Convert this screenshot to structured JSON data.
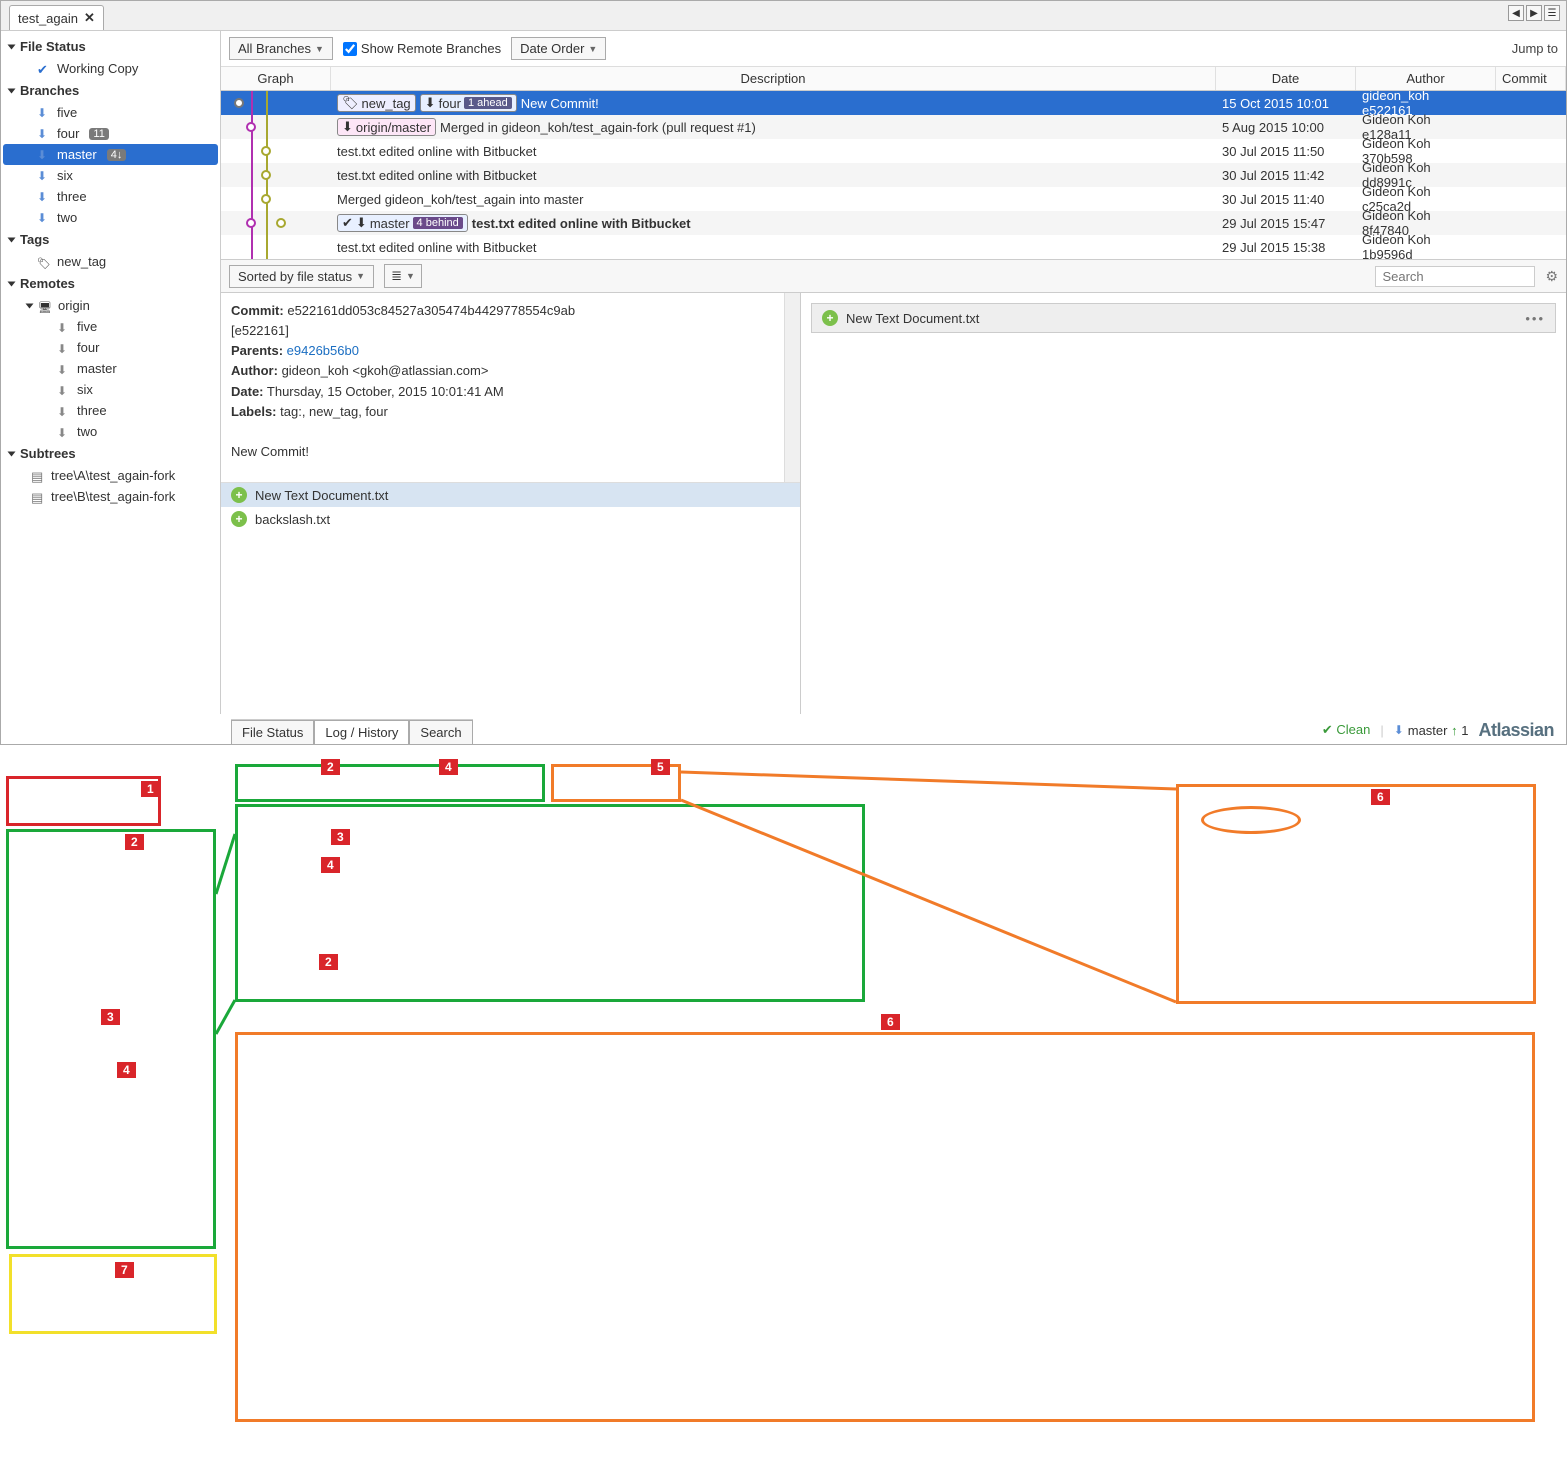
{
  "tab": {
    "name": "test_again"
  },
  "jump_label": "Jump to",
  "sidebar": {
    "file_status": {
      "title": "File Status",
      "items": [
        {
          "label": "Working Copy"
        }
      ]
    },
    "branches": {
      "title": "Branches",
      "items": [
        {
          "label": "five"
        },
        {
          "label": "four",
          "count": "11"
        },
        {
          "label": "master",
          "count": "4↓",
          "active": true
        },
        {
          "label": "six"
        },
        {
          "label": "three"
        },
        {
          "label": "two"
        }
      ]
    },
    "tags": {
      "title": "Tags",
      "items": [
        {
          "label": "new_tag"
        }
      ]
    },
    "remotes": {
      "title": "Remotes",
      "origin": {
        "label": "origin",
        "items": [
          {
            "label": "five"
          },
          {
            "label": "four"
          },
          {
            "label": "master"
          },
          {
            "label": "six"
          },
          {
            "label": "three"
          },
          {
            "label": "two"
          }
        ]
      }
    },
    "subtrees": {
      "title": "Subtrees",
      "items": [
        {
          "label": "tree\\A\\test_again-fork"
        },
        {
          "label": "tree\\B\\test_again-fork"
        }
      ]
    }
  },
  "toolbar": {
    "all_branches": "All Branches",
    "show_remote": "Show Remote Branches",
    "date_order": "Date Order"
  },
  "log": {
    "headers": {
      "graph": "Graph",
      "desc": "Description",
      "date": "Date",
      "author": "Author",
      "commit": "Commit"
    },
    "rows": [
      {
        "selected": true,
        "tags": [
          {
            "kind": "tagp",
            "label": "new_tag"
          },
          {
            "kind": "localb",
            "label": "four",
            "extra": "1 ahead",
            "extraKind": "ahead"
          }
        ],
        "desc": "New Commit!",
        "date": "15 Oct 2015 10:01",
        "author": "gideon_koh <gkoh",
        "commit": "e522161",
        "dots": [
          {
            "x": 18,
            "c": "#777"
          }
        ]
      },
      {
        "tags": [
          {
            "kind": "remb",
            "label": "origin/master"
          }
        ],
        "desc": "Merged in gideon_koh/test_again-fork (pull request #1)",
        "date": "5 Aug 2015 10:00",
        "author": "Gideon Koh <gkoh",
        "commit": "e128a11",
        "dots": [
          {
            "x": 30,
            "c": "#b030b0"
          }
        ]
      },
      {
        "desc": "test.txt edited online with Bitbucket",
        "date": "30 Jul 2015 11:50",
        "author": "Gideon Koh <gkoh",
        "commit": "370b598",
        "dots": [
          {
            "x": 45,
            "c": "#a8a830"
          }
        ]
      },
      {
        "desc": "test.txt edited online with Bitbucket",
        "date": "30 Jul 2015 11:42",
        "author": "Gideon Koh <gkoh",
        "commit": "dd8991c",
        "dots": [
          {
            "x": 45,
            "c": "#a8a830"
          }
        ]
      },
      {
        "desc": "Merged gideon_koh/test_again into master",
        "date": "30 Jul 2015 11:40",
        "author": "Gideon Koh <gkoh",
        "commit": "c25ca2d",
        "dots": [
          {
            "x": 45,
            "c": "#a8a830"
          }
        ]
      },
      {
        "bold": true,
        "tags": [
          {
            "kind": "localb",
            "label": "master",
            "extra": "4 behind",
            "extraKind": "behind",
            "cur": true
          }
        ],
        "desc": "test.txt edited online with Bitbucket",
        "date": "29 Jul 2015 15:47",
        "author": "Gideon Koh <gkoh",
        "commit": "8f47840",
        "dots": [
          {
            "x": 30,
            "c": "#b030b0"
          },
          {
            "x": 60,
            "c": "#a8a830"
          }
        ]
      },
      {
        "desc": "test.txt edited online with Bitbucket",
        "date": "29 Jul 2015 15:38",
        "author": "Gideon Koh <gkoh",
        "commit": "1b9596d",
        "dots": []
      }
    ]
  },
  "detail_bar": {
    "sorted": "Sorted by file status",
    "search_ph": "Search"
  },
  "commit_detail": {
    "commit_lbl": "Commit:",
    "commit_val": "e522161dd053c84527a305474b4429778554c9ab",
    "short": "[e522161]",
    "parents_lbl": "Parents:",
    "parents_val": "e9426b56b0",
    "author_lbl": "Author:",
    "author_val": "gideon_koh <gkoh@atlassian.com>",
    "date_lbl": "Date:",
    "date_val": "Thursday, 15 October, 2015 10:01:41 AM",
    "labels_lbl": "Labels:",
    "labels_val": "tag:, new_tag, four",
    "msg": "New Commit!"
  },
  "files": [
    {
      "name": "New Text Document.txt",
      "selected": true
    },
    {
      "name": "backslash.txt"
    }
  ],
  "diff": {
    "file": "New Text Document.txt"
  },
  "bottom_tabs": {
    "t1": "File Status",
    "t2": "Log / History",
    "t3": "Search"
  },
  "status": {
    "clean": "Clean",
    "branch": "master",
    "ahead": "1",
    "brand": "Atlassian"
  }
}
